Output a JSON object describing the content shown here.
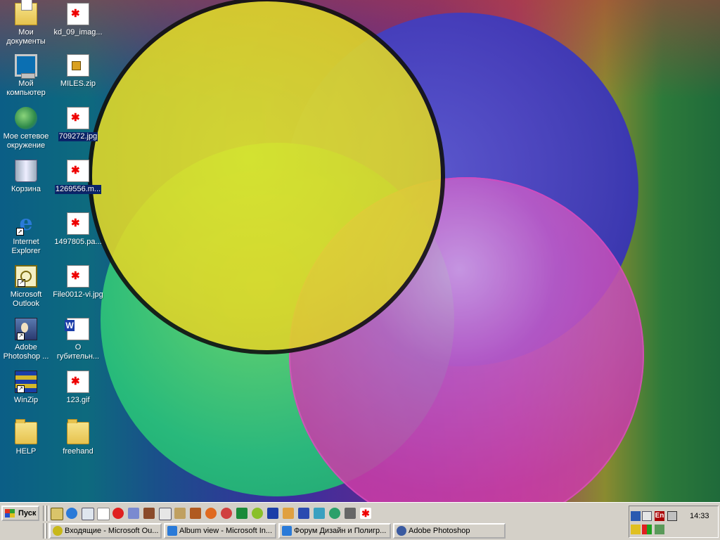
{
  "desktop": {
    "icons": [
      {
        "id": "my-documents",
        "label": "Мои документы",
        "glyph": "mydocs"
      },
      {
        "id": "kd09",
        "label": "kd_09_imag...",
        "glyph": "doc"
      },
      {
        "id": "my-computer",
        "label": "Мой компьютер",
        "glyph": "pc"
      },
      {
        "id": "miles-zip",
        "label": "MILES.zip",
        "glyph": "zipdoc"
      },
      {
        "id": "network",
        "label": "Мое сетевое окружение",
        "glyph": "net"
      },
      {
        "id": "f709272",
        "label": "709272.jpg",
        "glyph": "doc"
      },
      {
        "id": "recycle",
        "label": "Корзина",
        "glyph": "bin"
      },
      {
        "id": "f1269556",
        "label": "1269556.m...",
        "glyph": "doc"
      },
      {
        "id": "ie",
        "label": "Internet Explorer",
        "glyph": "ie"
      },
      {
        "id": "f1497805",
        "label": "1497805.pa...",
        "glyph": "doc"
      },
      {
        "id": "outlook",
        "label": "Microsoft Outlook",
        "glyph": "outlook"
      },
      {
        "id": "file0012",
        "label": "File0012-vi.jpg",
        "glyph": "doc"
      },
      {
        "id": "photoshop",
        "label": "Adobe Photoshop ...",
        "glyph": "ps"
      },
      {
        "id": "o-gub",
        "label": "О губительн...",
        "glyph": "word"
      },
      {
        "id": "winzip",
        "label": "WinZip",
        "glyph": "winzip"
      },
      {
        "id": "f123gif",
        "label": "123.gif",
        "glyph": "doc"
      },
      {
        "id": "help",
        "label": "HELP",
        "glyph": "folder"
      },
      {
        "id": "freehand",
        "label": "freehand",
        "glyph": "folder"
      }
    ]
  },
  "taskbar": {
    "start_label": "Пуск",
    "tasks": [
      {
        "label": "Входящие - Microsoft Ou...",
        "color": "#c8b81a"
      },
      {
        "label": "Album view - Microsoft In...",
        "color": "#2a7ad8"
      },
      {
        "label": "Форум Дизайн и Полигр...",
        "color": "#2a7ad8"
      },
      {
        "label": "Adobe Photoshop",
        "color": "#3a5aa0"
      }
    ],
    "tray": {
      "lang": "En",
      "clock": "14:33"
    }
  },
  "colors": {
    "selection": "#0a246a",
    "taskbar": "#d4d0c8"
  }
}
